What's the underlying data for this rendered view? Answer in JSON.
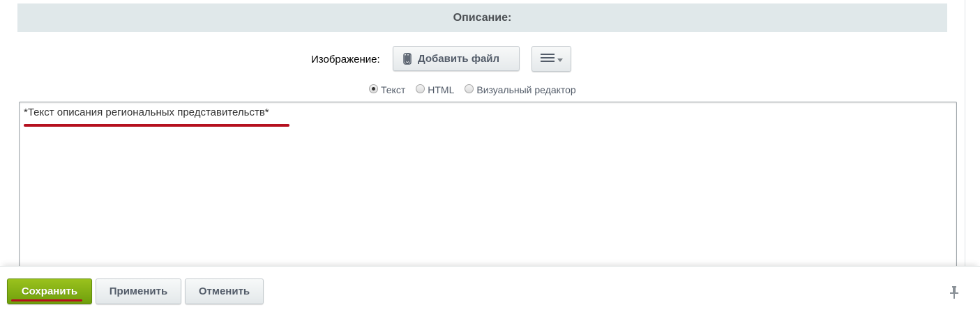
{
  "section": {
    "title": "Описание:"
  },
  "image_field": {
    "label": "Изображение:",
    "add_file_button": "Добавить файл"
  },
  "editor_modes": [
    {
      "label": "Текст",
      "checked": true
    },
    {
      "label": "HTML",
      "checked": false
    },
    {
      "label": "Визуальный редактор",
      "checked": false
    }
  ],
  "description": {
    "value": "*Текст описания региональных представительств*"
  },
  "footer": {
    "save_label": "Сохранить",
    "apply_label": "Применить",
    "cancel_label": "Отменить"
  },
  "icons": {
    "attach": "paperclip-icon",
    "menu": "hamburger-menu-icon",
    "dropdown": "caret-down-icon",
    "pin": "pin-icon"
  },
  "colors": {
    "save_button": "#7fae14",
    "annotation_underline": "#b5101f",
    "section_header_bg": "#e0e8ea"
  }
}
